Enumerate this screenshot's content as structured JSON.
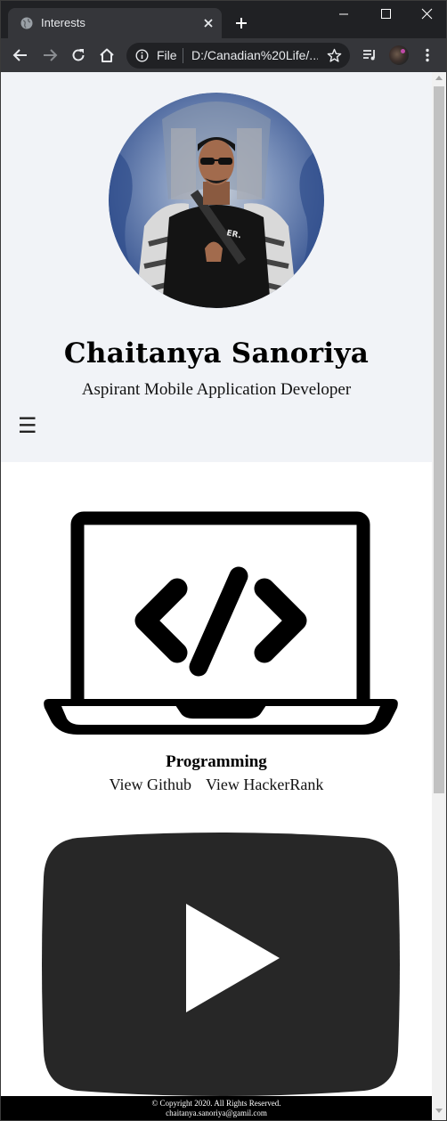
{
  "browser": {
    "tab_title": "Interests",
    "omnibox_scheme_label": "File",
    "omnibox_url": "D:/Canadian%20Life/...",
    "colors": {
      "frame": "#202124",
      "toolbar": "#35363a",
      "text": "#e8eaed"
    }
  },
  "profile": {
    "name": "Chaitanya Sanoriya",
    "tagline": "Aspirant Mobile Application Developer",
    "menu_glyph": "☰"
  },
  "interests": [
    {
      "icon": "laptop-code-icon",
      "title": "Programming",
      "links": [
        "View Github",
        "View HackerRank"
      ]
    },
    {
      "icon": "youtube-play-icon",
      "title": "",
      "links": []
    }
  ],
  "footer": {
    "copyright": "© Copyright 2020. All Rights Reserved.",
    "email": "chaitanya.sanoriya@gamil.com"
  },
  "colors": {
    "header_band": "#f1f3f7",
    "youtube_icon": "#272727",
    "footer_bg": "#000000"
  }
}
